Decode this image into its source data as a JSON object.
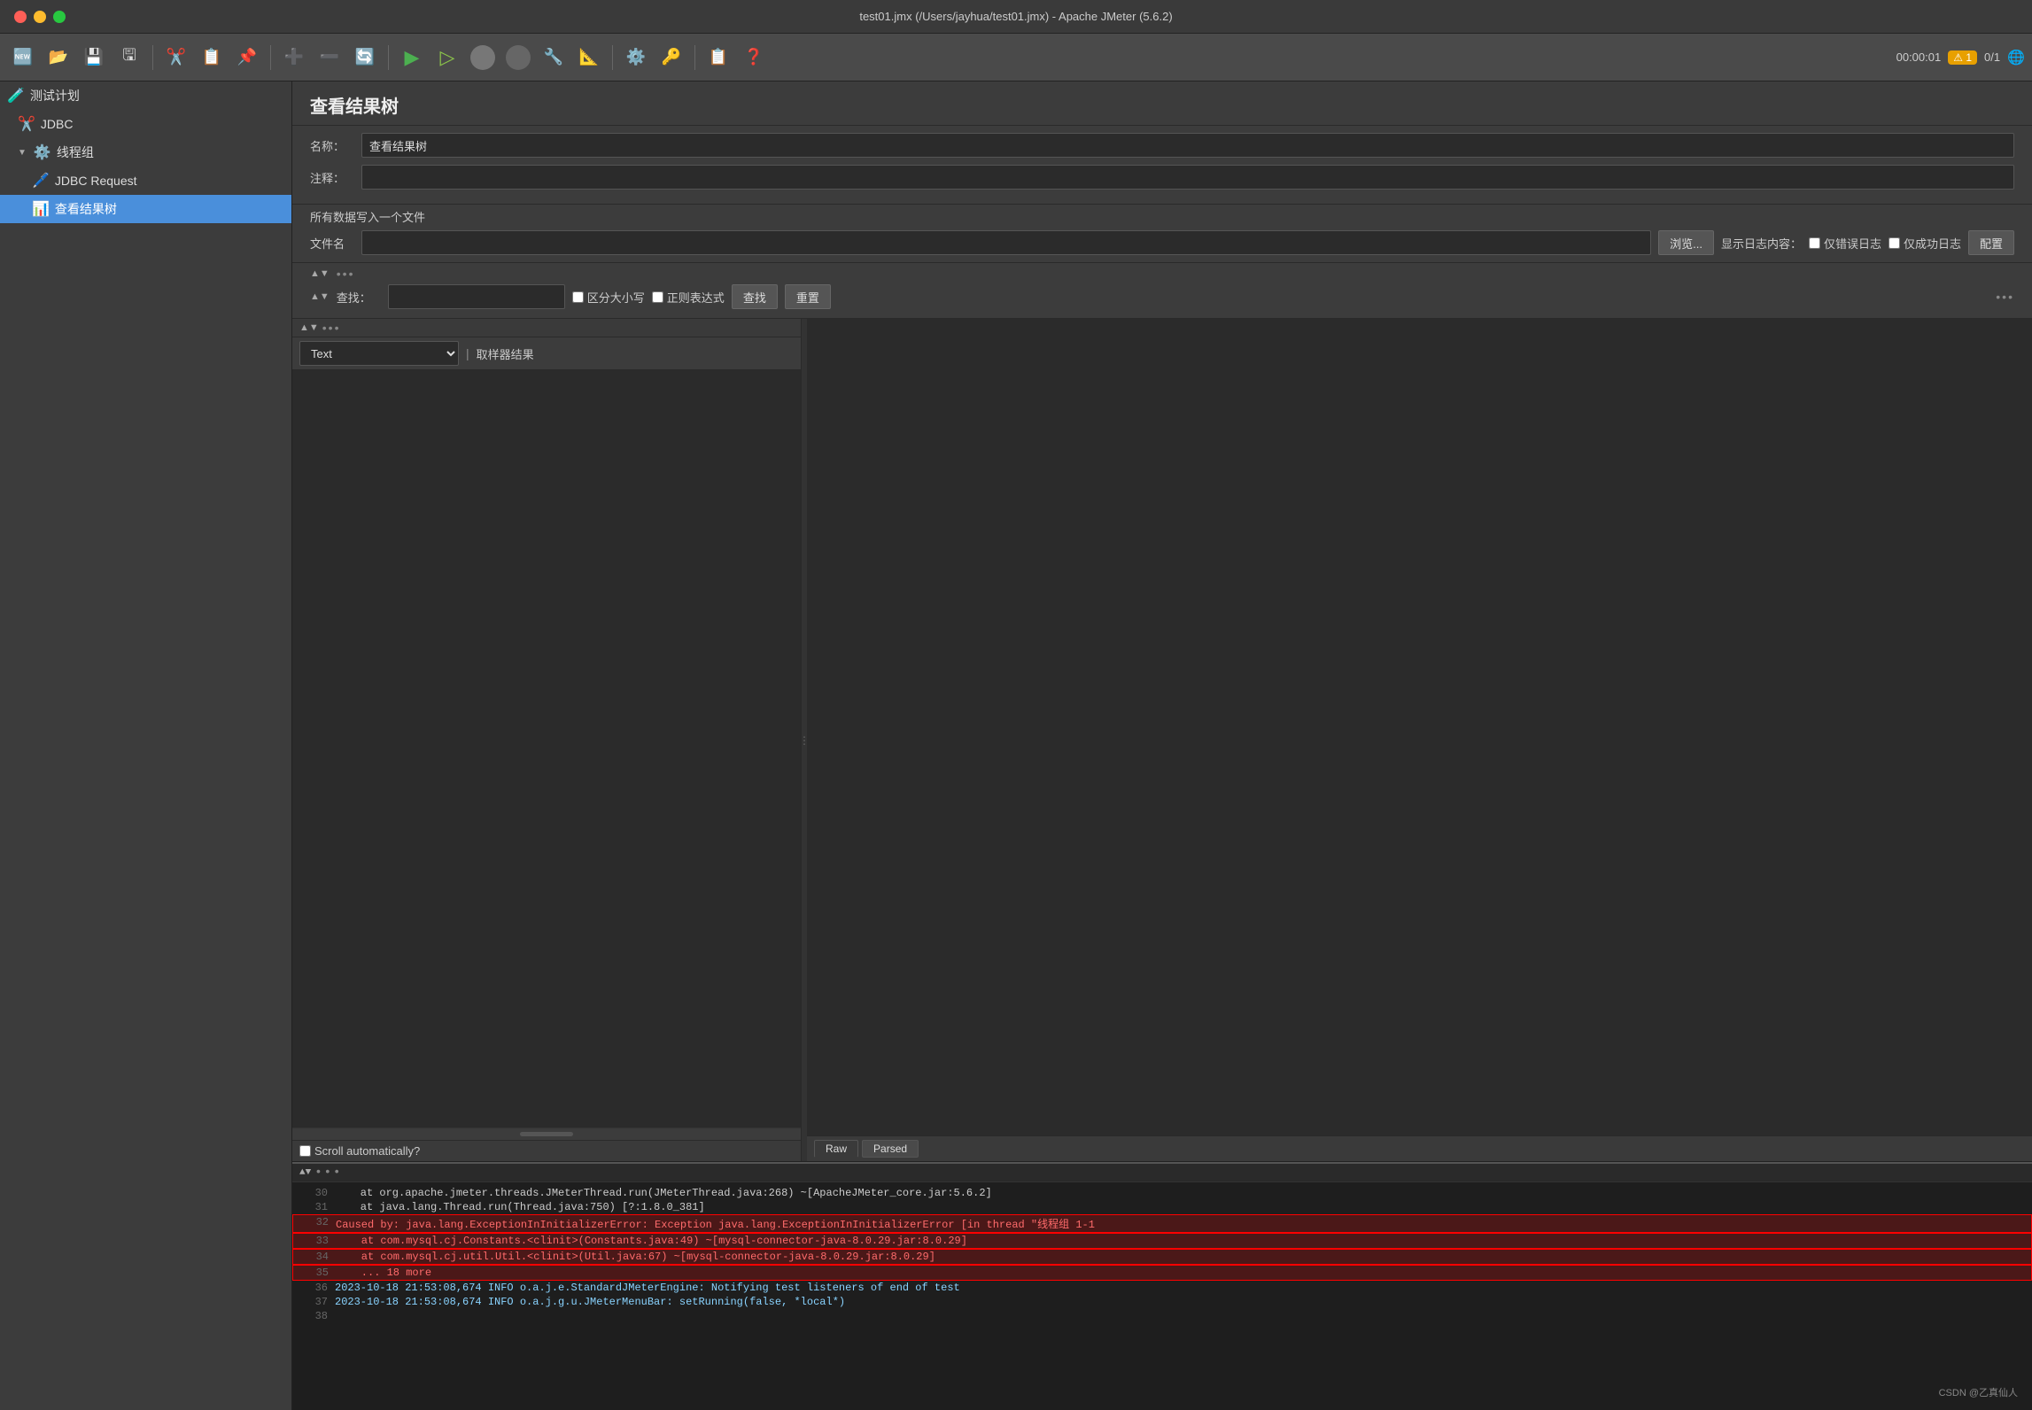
{
  "titlebar": {
    "title": "test01.jmx (/Users/jayhua/test01.jmx) - Apache JMeter (5.6.2)"
  },
  "toolbar": {
    "timer": "00:00:01",
    "warnings": "1",
    "runs": "0/1"
  },
  "sidebar": {
    "items": [
      {
        "id": "test-plan",
        "label": "测试计划",
        "icon": "🧪",
        "indent": 0
      },
      {
        "id": "jdbc",
        "label": "JDBC",
        "icon": "✂️",
        "indent": 1
      },
      {
        "id": "thread-group",
        "label": "线程组",
        "icon": "⚙️",
        "indent": 1
      },
      {
        "id": "jdbc-request",
        "label": "JDBC Request",
        "icon": "🖊️",
        "indent": 2
      },
      {
        "id": "view-results-tree",
        "label": "查看结果树",
        "icon": "📊",
        "indent": 2,
        "selected": true
      }
    ]
  },
  "main": {
    "page_title": "查看结果树",
    "name_label": "名称：",
    "name_value": "查看结果树",
    "comment_label": "注释：",
    "comment_value": "",
    "file_section_title": "所有数据写入一个文件",
    "file_name_label": "文件名",
    "file_name_value": "",
    "browse_btn": "浏览...",
    "show_log_label": "显示日志内容：",
    "error_log_label": "仅错误日志",
    "success_log_label": "仅成功日志",
    "config_btn": "配置",
    "search_label": "查找：",
    "case_sensitive_label": "区分大小写",
    "regex_label": "正则表达式",
    "find_btn": "查找",
    "reset_btn": "重置",
    "text_dropdown": "Text",
    "sampler_result_tab": "取样器结果",
    "scroll_checkbox": "Scroll automatically?",
    "raw_tab": "Raw",
    "parsed_tab": "Parsed"
  },
  "log": {
    "lines": [
      {
        "num": "30",
        "text": "    at org.apache.jmeter.threads.JMeterThread.run(JMeterThread.java:268) ~[ApacheJMeter_core.jar:5.6.2]",
        "type": "normal"
      },
      {
        "num": "31",
        "text": "    at java.lang.Thread.run(Thread.java:750) [?:1.8.0_381]",
        "type": "normal"
      },
      {
        "num": "32",
        "text": "Caused by: java.lang.ExceptionInInitializerError: Exception java.lang.ExceptionInInitializerError [in thread \"线程组 1-1",
        "type": "error",
        "highlight": true
      },
      {
        "num": "33",
        "text": "    at com.mysql.cj.Constants.<clinit>(Constants.java:49) ~[mysql-connector-java-8.0.29.jar:8.0.29]",
        "type": "error",
        "highlight": true
      },
      {
        "num": "34",
        "text": "    at com.mysql.cj.util.Util.<clinit>(Util.java:67) ~[mysql-connector-java-8.0.29.jar:8.0.29]",
        "type": "error",
        "highlight": true
      },
      {
        "num": "35",
        "text": "    ... 18 more",
        "type": "error",
        "highlight": true
      },
      {
        "num": "36",
        "text": "2023-10-18 21:53:08,674 INFO o.a.j.e.StandardJMeterEngine: Notifying test listeners of end of test",
        "type": "info"
      },
      {
        "num": "37",
        "text": "2023-10-18 21:53:08,674 INFO o.a.j.g.u.JMeterMenuBar: setRunning(false, *local*)",
        "type": "info"
      },
      {
        "num": "38",
        "text": "",
        "type": "normal"
      }
    ]
  },
  "watermark": "CSDN @乙真仙人"
}
